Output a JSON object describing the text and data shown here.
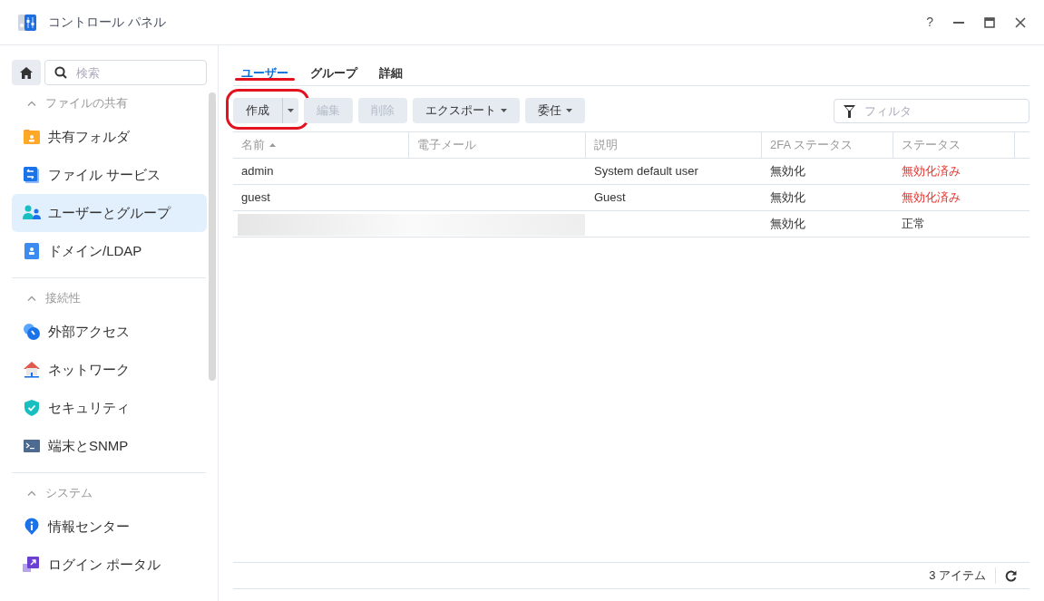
{
  "window": {
    "title": "コントロール パネル",
    "help_label": "?"
  },
  "sidebar": {
    "search": {
      "placeholder": "検索"
    },
    "sections": [
      {
        "title": "ファイルの共有",
        "expanded": true,
        "items": [
          {
            "label": "共有フォルダ",
            "selected": false
          },
          {
            "label": "ファイル サービス",
            "selected": false
          },
          {
            "label": "ユーザーとグループ",
            "selected": true
          },
          {
            "label": "ドメイン/LDAP",
            "selected": false
          }
        ]
      },
      {
        "title": "接続性",
        "expanded": true,
        "items": [
          {
            "label": "外部アクセス",
            "selected": false
          },
          {
            "label": "ネットワーク",
            "selected": false
          },
          {
            "label": "セキュリティ",
            "selected": false
          },
          {
            "label": "端末とSNMP",
            "selected": false
          }
        ]
      },
      {
        "title": "システム",
        "expanded": true,
        "items": [
          {
            "label": "情報センター",
            "selected": false
          },
          {
            "label": "ログイン ポータル",
            "selected": false
          }
        ]
      }
    ]
  },
  "tabs": [
    {
      "label": "ユーザー",
      "selected": true,
      "highlighted": true
    },
    {
      "label": "グループ",
      "selected": false,
      "highlighted": false
    },
    {
      "label": "詳細",
      "selected": false,
      "highlighted": false
    }
  ],
  "toolbar": {
    "buttons": [
      {
        "label": "作成",
        "kind": "split",
        "disabled": false,
        "highlighted": true
      },
      {
        "label": "編集",
        "kind": "plain",
        "disabled": true,
        "highlighted": false
      },
      {
        "label": "削除",
        "kind": "plain",
        "disabled": true,
        "highlighted": false
      },
      {
        "label": "エクスポート",
        "kind": "dropdown",
        "disabled": false,
        "highlighted": false
      },
      {
        "label": "委任",
        "kind": "dropdown",
        "disabled": false,
        "highlighted": false
      }
    ],
    "filter": {
      "placeholder": "フィルタ"
    }
  },
  "table": {
    "columns": [
      {
        "label": "名前",
        "sorted": true
      },
      {
        "label": "電子メール",
        "sorted": false
      },
      {
        "label": "説明",
        "sorted": false
      },
      {
        "label": "2FA ステータス",
        "sorted": false
      },
      {
        "label": "ステータス",
        "sorted": false
      }
    ],
    "rows": [
      {
        "redacted": false,
        "name": "admin",
        "description": "System default user",
        "two_fa": "無効化",
        "status": "無効化済み",
        "status_alert": true
      },
      {
        "redacted": false,
        "name": "guest",
        "description": "Guest",
        "two_fa": "無効化",
        "status": "無効化済み",
        "status_alert": true
      },
      {
        "redacted": true,
        "two_fa": "無効化",
        "status": "正常",
        "status_alert": false
      }
    ]
  },
  "status_bar": {
    "count": "3 アイテム"
  }
}
